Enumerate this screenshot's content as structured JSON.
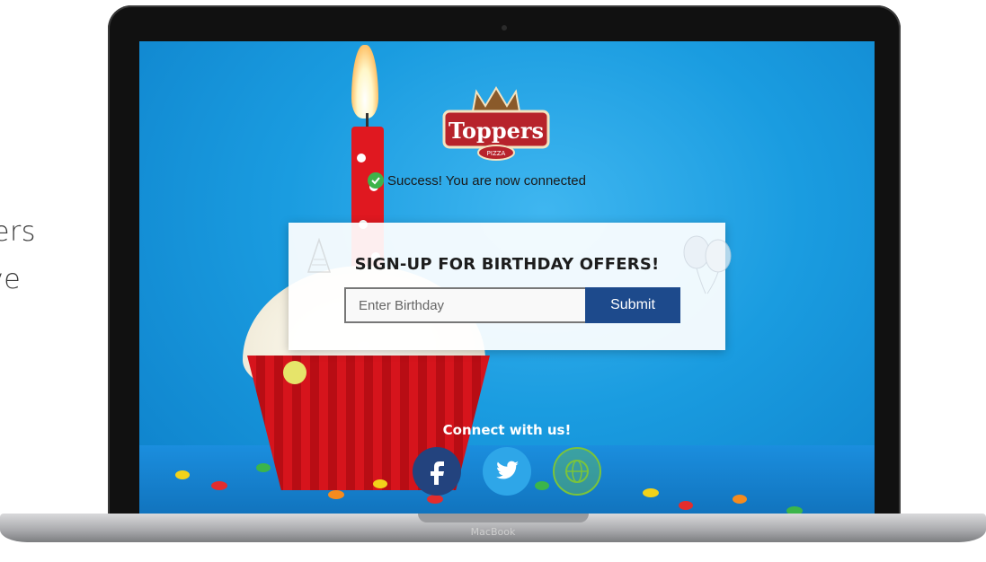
{
  "side_text": {
    "line1": "ers",
    "line2": "ve"
  },
  "device": {
    "label": "MacBook"
  },
  "brand": {
    "logo_text": "Toppers",
    "logo_subtext": "PIZZA"
  },
  "status": {
    "message": "Success! You are now connected"
  },
  "signup": {
    "title": "SIGN-UP FOR BIRTHDAY OFFERS!",
    "input_placeholder": "Enter Birthday",
    "submit_label": "Submit"
  },
  "social": {
    "heading": "Connect with us!",
    "icons": [
      "facebook-icon",
      "twitter-icon",
      "website-globe-icon"
    ]
  },
  "colors": {
    "screen_bg": "#1a9ce0",
    "submit_bg": "#1d4a8c",
    "facebook": "#23437e",
    "twitter": "#2ea6e8",
    "success": "#3db34a"
  }
}
